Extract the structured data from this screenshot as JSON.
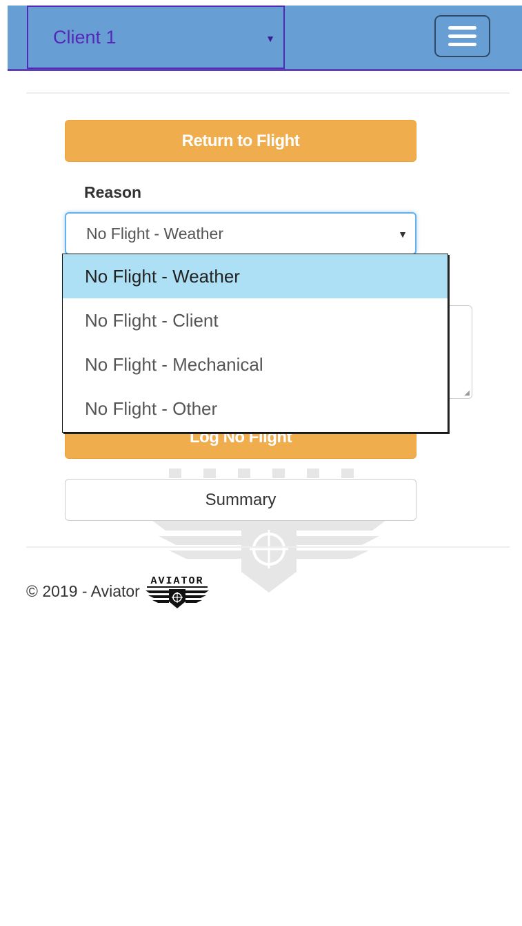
{
  "header": {
    "client_select_value": "Client 1"
  },
  "actions": {
    "return_label": "Return to Flight",
    "log_label": "Log No Flight",
    "summary_label": "Summary"
  },
  "form": {
    "reason_label": "Reason",
    "reason_value": "No Flight - Weather",
    "options": [
      "No Flight - Weather",
      "No Flight - Client",
      "No Flight - Mechanical",
      "No Flight - Other"
    ]
  },
  "footer": {
    "copyright": "© 2019 - Aviator",
    "logo_text": "AVIATOR"
  },
  "colors": {
    "navbar": "#679fd4",
    "accent_orange": "#f0ad4e",
    "select_text": "#5628b8",
    "option_highlight": "#aee0f5"
  }
}
